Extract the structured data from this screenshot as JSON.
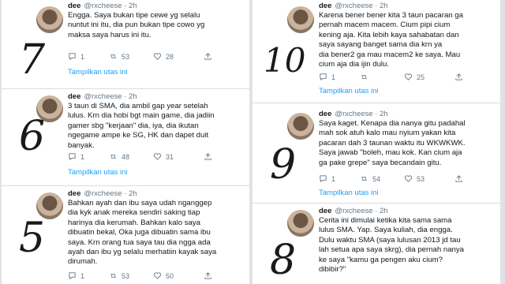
{
  "tweets": [
    {
      "handle_line": "@rxcheese · 2h",
      "name": "dee",
      "text": "Engga. Saya bukan tipe cewe yg selalu\nnuntut ini itu, dia pun bukan tipe cowo yg\nmaksa saya harus ini itu.",
      "replies": "1",
      "retweets": "53",
      "likes": "28",
      "thread": "Tampilkan utas ini",
      "number": "7"
    },
    {
      "handle_line": "@rxcheese · 2h",
      "name": "dee",
      "text": "3 taun di SMA, dia ambil gap year setelah\nlulus. Krn dia hobi bgt main game, dia jadiin\ngamer sbg \"kerjaan\" dia, iya, dia ikutan\nngegame ampe ke SG, HK dan dapet duit\nbanyak.",
      "replies": "1",
      "retweets": "48",
      "likes": "31",
      "thread": "Tampilkan utas ini",
      "number": "6"
    },
    {
      "handle_line": "@rxcheese · 2h",
      "name": "dee",
      "text": "Bahkan ayah dan ibu saya udah nganggep\ndia kyk anak mereka sendiri saking tiap\nharinya dia kerumah. Bahkan kalo saya\ndibuatin bekal, Oka juga dibuatin sama ibu\nsaya. Krn orang tua saya tau dia ngga ada\nayah dan ibu yg selalu merhatiin kayak saya\ndirumah.",
      "replies": "1",
      "retweets": "53",
      "likes": "50",
      "thread": "",
      "number": "5"
    },
    {
      "handle_line": "@rxcheese · 2h",
      "name": "dee",
      "text": "Karena bener bener kita 3 taun pacaran ga\npernah macem macem. Cium pipi cium\nkening aja. Kita lebih kaya sahabatan dan\nsaya sayang banget sama dia krn ya\ndia bener2 ga mau macem2 ke saya. Mau\ncium aja dia ijin dulu.",
      "replies": "1",
      "retweets": "",
      "likes": "25",
      "thread": "Tampilkan utas ini",
      "number": "10"
    },
    {
      "handle_line": "@rxcheese · 2h",
      "name": "dee",
      "text": "Saya kaget. Kenapa dia nanya gitu padahal\nmah sok atuh kalo mau nyium yakan kita\npacaran dah 3 taunan waktu itu WKWKWK.\nSaya jawab \"boleh, mau kok. Kan cium aja\nga pake grepe\" saya becandain gitu.",
      "replies": "1",
      "retweets": "54",
      "likes": "53",
      "thread": "Tampilkan utas ini",
      "number": "9"
    },
    {
      "handle_line": "@rxcheese · 2h",
      "name": "dee",
      "text": "Cerita ini dimulai ketika kita sama sama\nlulus SMA. Yap. Saya kuliah, dia engga.\nDulu waktu SMA (saya lulusan 2013 jd tau\nlah setua apa saya skrg), dia pernah nanya\nke saya \"kamu ga pengen aku cium?\ndibibir?\"",
      "replies": "",
      "retweets": "",
      "likes": "",
      "thread": "",
      "number": "8"
    }
  ]
}
